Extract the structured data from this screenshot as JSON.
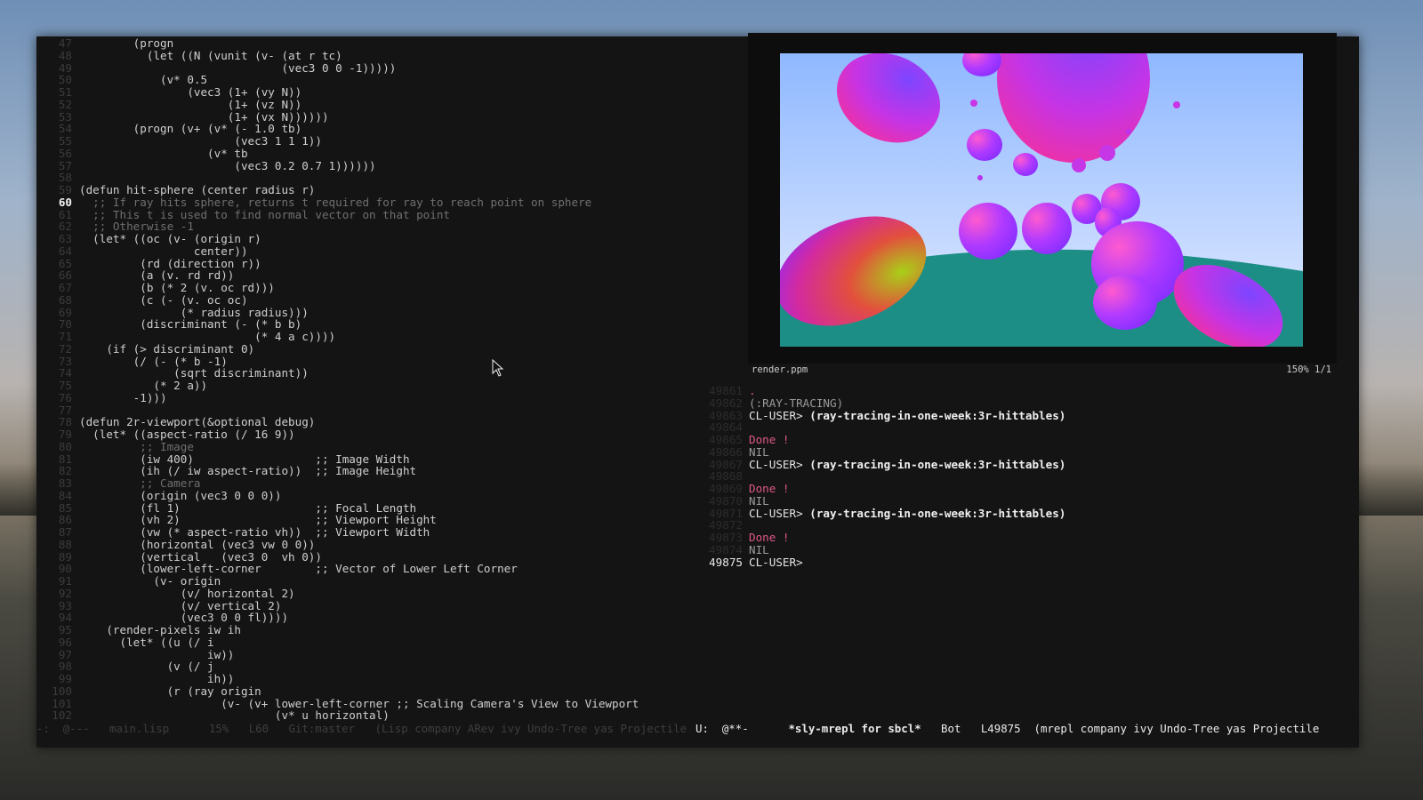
{
  "editor": {
    "lines": [
      {
        "num": "47",
        "text": "        (progn"
      },
      {
        "num": "48",
        "text": "          (let ((N (vunit (v- (at r tc)"
      },
      {
        "num": "49",
        "text": "                              (vec3 0 0 -1)))))"
      },
      {
        "num": "50",
        "text": "            (v* 0.5"
      },
      {
        "num": "51",
        "text": "                (vec3 (1+ (vy N))"
      },
      {
        "num": "52",
        "text": "                      (1+ (vz N))"
      },
      {
        "num": "53",
        "text": "                      (1+ (vx N))))))"
      },
      {
        "num": "54",
        "text": "        (progn (v+ (v* (- 1.0 tb)"
      },
      {
        "num": "55",
        "text": "                       (vec3 1 1 1))"
      },
      {
        "num": "56",
        "text": "                   (v* tb"
      },
      {
        "num": "57",
        "text": "                       (vec3 0.2 0.7 1))))))"
      },
      {
        "num": "58",
        "text": ""
      },
      {
        "num": "59",
        "text": "(defun hit-sphere (center radius r)"
      },
      {
        "num": "60",
        "text": "  ;; If ray hits sphere, returns t required for ray to reach point on sphere",
        "comment": true,
        "current": true
      },
      {
        "num": "61",
        "text": "  ;; This t is used to find normal vector on that point",
        "comment": true
      },
      {
        "num": "62",
        "text": "  ;; Otherwise -1",
        "comment": true
      },
      {
        "num": "63",
        "text": "  (let* ((oc (v- (origin r)"
      },
      {
        "num": "64",
        "text": "                 center))"
      },
      {
        "num": "65",
        "text": "         (rd (direction r))"
      },
      {
        "num": "66",
        "text": "         (a (v. rd rd))"
      },
      {
        "num": "67",
        "text": "         (b (* 2 (v. oc rd)))"
      },
      {
        "num": "68",
        "text": "         (c (- (v. oc oc)"
      },
      {
        "num": "69",
        "text": "               (* radius radius)))"
      },
      {
        "num": "70",
        "text": "         (discriminant (- (* b b)"
      },
      {
        "num": "71",
        "text": "                          (* 4 a c))))"
      },
      {
        "num": "72",
        "text": "    (if (> discriminant 0)"
      },
      {
        "num": "73",
        "text": "        (/ (- (* b -1)"
      },
      {
        "num": "74",
        "text": "              (sqrt discriminant))"
      },
      {
        "num": "75",
        "text": "           (* 2 a))"
      },
      {
        "num": "76",
        "text": "        -1)))"
      },
      {
        "num": "77",
        "text": ""
      },
      {
        "num": "78",
        "text": "(defun 2r-viewport(&optional debug)"
      },
      {
        "num": "79",
        "text": "  (let* ((aspect-ratio (/ 16 9))"
      },
      {
        "num": "80",
        "text": "         ;; Image",
        "comment": true
      },
      {
        "num": "81",
        "text": "         (iw 400)                  ;; Image Width"
      },
      {
        "num": "82",
        "text": "         (ih (/ iw aspect-ratio))  ;; Image Height"
      },
      {
        "num": "83",
        "text": "         ;; Camera",
        "comment": true
      },
      {
        "num": "84",
        "text": "         (origin (vec3 0 0 0))"
      },
      {
        "num": "85",
        "text": "         (fl 1)                    ;; Focal Length"
      },
      {
        "num": "86",
        "text": "         (vh 2)                    ;; Viewport Height"
      },
      {
        "num": "87",
        "text": "         (vw (* aspect-ratio vh))  ;; Viewport Width"
      },
      {
        "num": "88",
        "text": "         (horizontal (vec3 vw 0 0))"
      },
      {
        "num": "89",
        "text": "         (vertical   (vec3 0  vh 0))"
      },
      {
        "num": "90",
        "text": "         (lower-left-corner        ;; Vector of Lower Left Corner"
      },
      {
        "num": "91",
        "text": "           (v- origin"
      },
      {
        "num": "92",
        "text": "               (v/ horizontal 2)"
      },
      {
        "num": "93",
        "text": "               (v/ vertical 2)"
      },
      {
        "num": "94",
        "text": "               (vec3 0 0 fl))))"
      },
      {
        "num": "95",
        "text": "    (render-pixels iw ih"
      },
      {
        "num": "96",
        "text": "      (let* ((u (/ i"
      },
      {
        "num": "97",
        "text": "                   iw))"
      },
      {
        "num": "98",
        "text": "             (v (/ j"
      },
      {
        "num": "99",
        "text": "                   ih))"
      },
      {
        "num": "100",
        "text": "             (r (ray origin"
      },
      {
        "num": "101",
        "text": "                     (v- (v+ lower-left-corner ;; Scaling Camera's View to Viewport"
      },
      {
        "num": "102",
        "text": "                             (v* u horizontal)"
      }
    ],
    "mode_line": "-:  @---   main.lisp      15%   L60   Git:master   (Lisp company ARev ivy Undo-Tree yas Projectile"
  },
  "viewer": {
    "filename": "render.ppm",
    "zoom": "150%  1/1"
  },
  "repl": {
    "lines": [
      {
        "num": "49861",
        "text": ".",
        "cls": "done"
      },
      {
        "num": "49862",
        "text": "(:RAY-TRACING)",
        "cls": "dim"
      },
      {
        "num": "49863",
        "prompt": "CL-USER> ",
        "cmd": "(ray-tracing-in-one-week:3r-hittables)"
      },
      {
        "num": "49864",
        "text": ""
      },
      {
        "num": "49865",
        "text": "Done !",
        "cls": "done"
      },
      {
        "num": "49866",
        "text": "NIL",
        "cls": "dim"
      },
      {
        "num": "49867",
        "prompt": "CL-USER> ",
        "cmd": "(ray-tracing-in-one-week:3r-hittables)"
      },
      {
        "num": "49868",
        "text": ""
      },
      {
        "num": "49869",
        "text": "Done !",
        "cls": "done"
      },
      {
        "num": "49870",
        "text": "NIL",
        "cls": "dim"
      },
      {
        "num": "49871",
        "prompt": "CL-USER> ",
        "cmd": "(ray-tracing-in-one-week:3r-hittables)"
      },
      {
        "num": "49872",
        "text": ""
      },
      {
        "num": "49873",
        "text": "Done !",
        "cls": "done"
      },
      {
        "num": "49874",
        "text": "NIL",
        "cls": "dim"
      },
      {
        "num": "49875",
        "prompt": "CL-USER>",
        "cmd": "",
        "last": true
      }
    ],
    "mode_line": {
      "state": "U:  @**-",
      "buffer": "*sly-mrepl for sbcl*",
      "position": "Bot",
      "line": "L49875",
      "modes": "(mrepl company ivy Undo-Tree yas Projectile"
    }
  },
  "colors": {
    "bg": "#141414",
    "done": "#e0588a",
    "comment": "#6f6f6f"
  }
}
